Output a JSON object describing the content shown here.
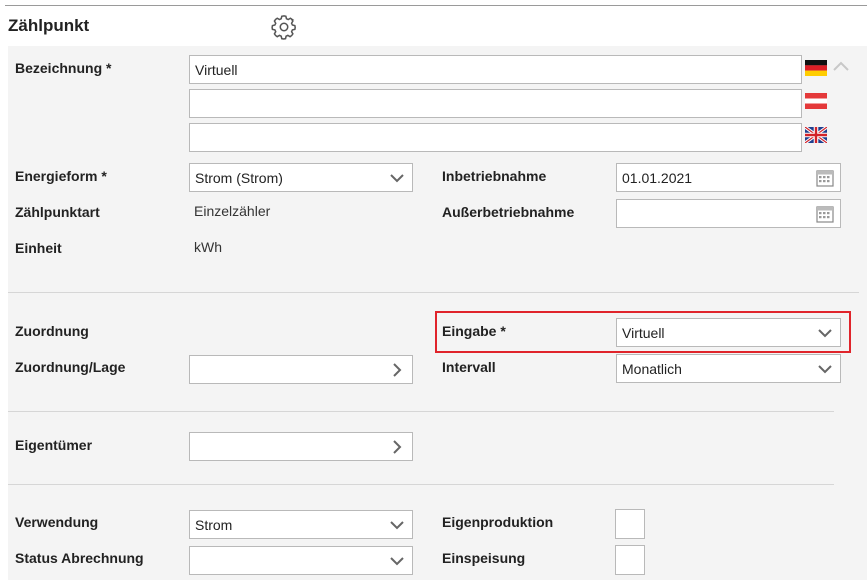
{
  "header": {
    "title": "Zählpunkt",
    "settings_icon": "gear-icon"
  },
  "fields": {
    "bezeichnung": {
      "label": "Bezeichnung *",
      "value_de": "Virtuell",
      "value_at": "",
      "value_en": ""
    },
    "energieform": {
      "label": "Energieform *",
      "value": "Strom (Strom)"
    },
    "zaehlpunktart": {
      "label": "Zählpunktart",
      "value": "Einzelzähler"
    },
    "einheit": {
      "label": "Einheit",
      "value": "kWh"
    },
    "inbetriebnahme": {
      "label": "Inbetriebnahme",
      "value": "01.01.2021"
    },
    "ausserbetriebnahme": {
      "label": "Außerbetriebnahme",
      "value": ""
    },
    "zuordnung": {
      "label": "Zuordnung"
    },
    "zuordnung_lage": {
      "label": "Zuordnung/Lage",
      "value": ""
    },
    "eingabe": {
      "label": "Eingabe *",
      "value": "Virtuell"
    },
    "intervall": {
      "label": "Intervall",
      "value": "Monatlich"
    },
    "eigentuemer": {
      "label": "Eigentümer",
      "value": ""
    },
    "verwendung": {
      "label": "Verwendung",
      "value": "Strom"
    },
    "status_abrechnung": {
      "label": "Status Abrechnung",
      "value": ""
    },
    "eigenproduktion": {
      "label": "Eigenproduktion",
      "checked": false
    },
    "einspeisung": {
      "label": "Einspeisung",
      "checked": false
    }
  },
  "colors": {
    "highlight": "#e0242b",
    "panel": "#f4f4f4"
  }
}
